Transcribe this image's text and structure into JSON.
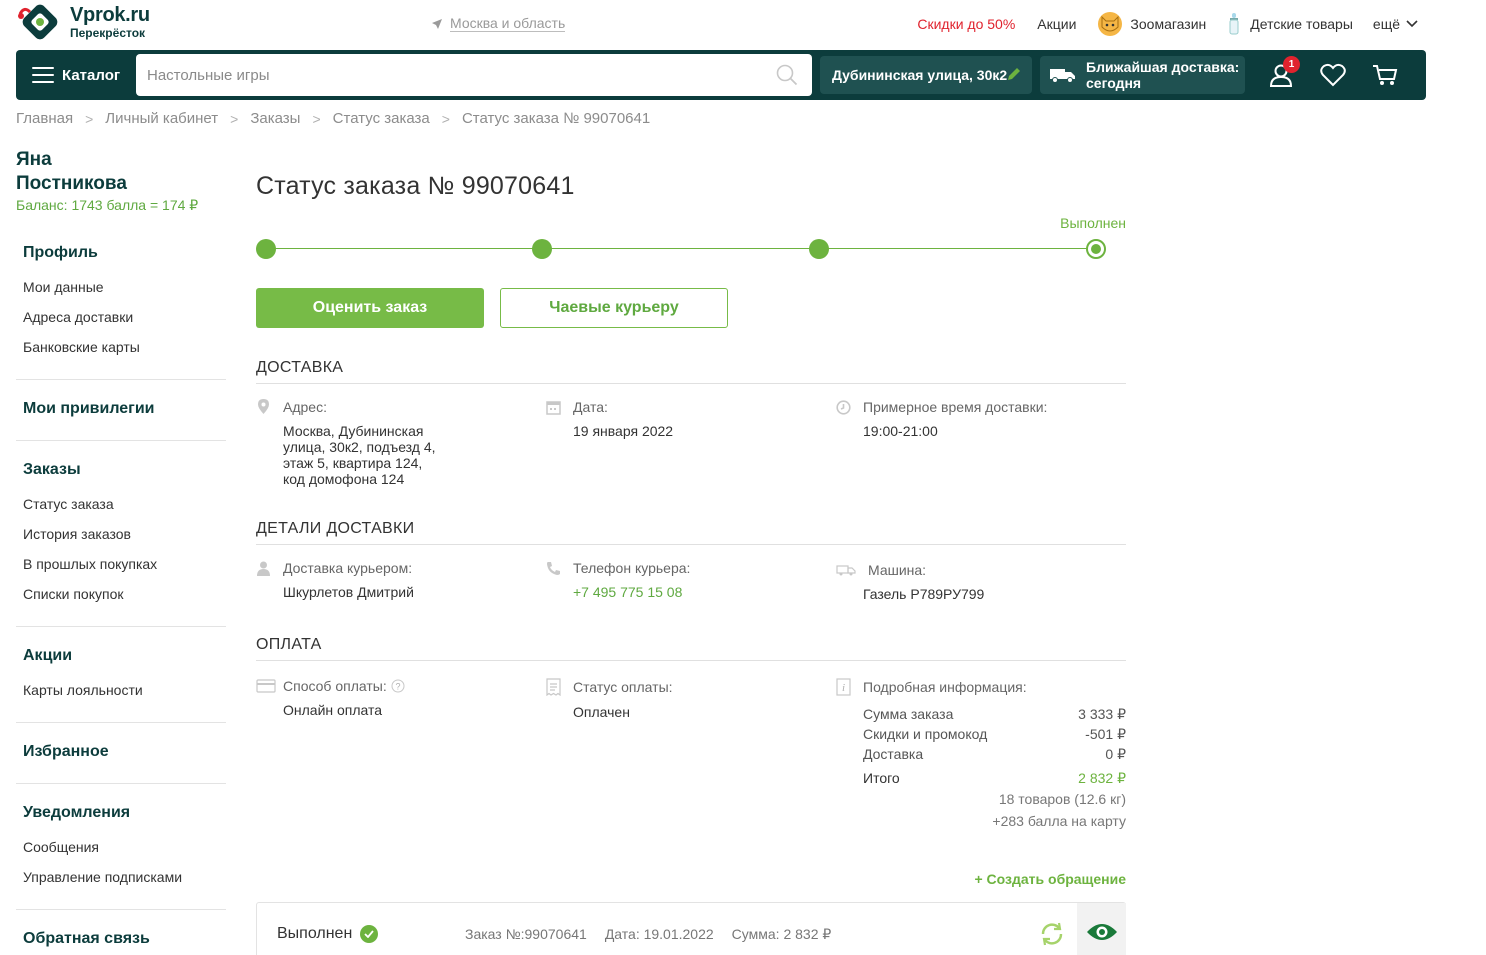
{
  "header": {
    "logo_title": "Vprok.ru",
    "logo_subtitle": "Перекрёсток",
    "region": "Москва и область",
    "links": {
      "sale": "Скидки до 50%",
      "promos": "Акции",
      "zoo": "Зоомагазин",
      "kids": "Детские товары",
      "more": "ещё"
    }
  },
  "navbar": {
    "catalog_label": "Каталог",
    "search_placeholder": "Настольные игры",
    "address": "Дубининская улица, 30к2",
    "delivery_line1": "Ближайшая доставка:",
    "delivery_line2": "сегодня",
    "profile_badge": "1"
  },
  "breadcrumb": [
    "Главная",
    "Личный кабинет",
    "Заказы",
    "Статус заказа",
    "Статус заказа № 99070641"
  ],
  "sidebar": {
    "user_first": "Яна",
    "user_last": "Постникова",
    "balance": "Баланс: 1743 балла = 174 ₽",
    "profile_head": "Профиль",
    "profile_items": [
      "Мои данные",
      "Адреса доставки",
      "Банковские карты"
    ],
    "privileges_head": "Мои привилегии",
    "orders_head": "Заказы",
    "orders_items": [
      "Статус заказа",
      "История заказов",
      "В прошлых покупках",
      "Списки покупок"
    ],
    "promos_head": "Акции",
    "promos_items": [
      "Карты лояльности"
    ],
    "favorites_head": "Избранное",
    "notifications_head": "Уведомления",
    "notifications_items": [
      "Сообщения",
      "Управление подписками"
    ],
    "feedback_head": "Обратная связь"
  },
  "main": {
    "title": "Статус заказа № 99070641",
    "status_label": "Выполнен",
    "progress_steps_done": 4,
    "progress_steps_total": 4,
    "rate_button": "Оценить заказ",
    "tips_button": "Чаевые курьеру",
    "delivery": {
      "title": "ДОСТАВКА",
      "address_label": "Адрес:",
      "address_lines": [
        "Москва, Дубининская",
        "улица, 30к2, подъезд 4,",
        "этаж 5, квартира 124,",
        "код домофона 124"
      ],
      "date_label": "Дата:",
      "date_value": "19 января 2022",
      "time_label": "Примерное время доставки:",
      "time_value": "19:00-21:00"
    },
    "details": {
      "title": "ДЕТАЛИ ДОСТАВКИ",
      "courier_label": "Доставка курьером:",
      "courier_value": "Шкурлетов Дмитрий",
      "phone_label": "Телефон курьера:",
      "phone_value": "+7 495 775 15 08",
      "car_label": "Машина:",
      "car_value": "Газель Р789РУ799"
    },
    "payment": {
      "title": "ОПЛАТА",
      "method_label": "Способ оплаты:",
      "method_value": "Онлайн оплата",
      "status_label": "Статус оплаты:",
      "status_value": "Оплачен",
      "info_label": "Подробная информация:",
      "rows": [
        {
          "k": "Сумма заказа",
          "v": "3 333 ₽"
        },
        {
          "k": "Скидки и промокод",
          "v": "-501 ₽"
        },
        {
          "k": "Доставка",
          "v": "0 ₽"
        }
      ],
      "total_label": "Итого",
      "total_value": "2 832 ₽",
      "items_count": "18 товаров (12.6 кг)",
      "bonus": "+283 балла на карту"
    },
    "create_request": "+ Создать обращение",
    "order_card": {
      "status": "Выполнен",
      "number": "Заказ №:99070641",
      "date": "Дата: 19.01.2022",
      "sum": "Сумма: 2 832 ₽"
    }
  },
  "colors": {
    "brand_dark": "#0c3c3c",
    "accent_green": "#77bb47",
    "sale_red": "#e0232e"
  }
}
